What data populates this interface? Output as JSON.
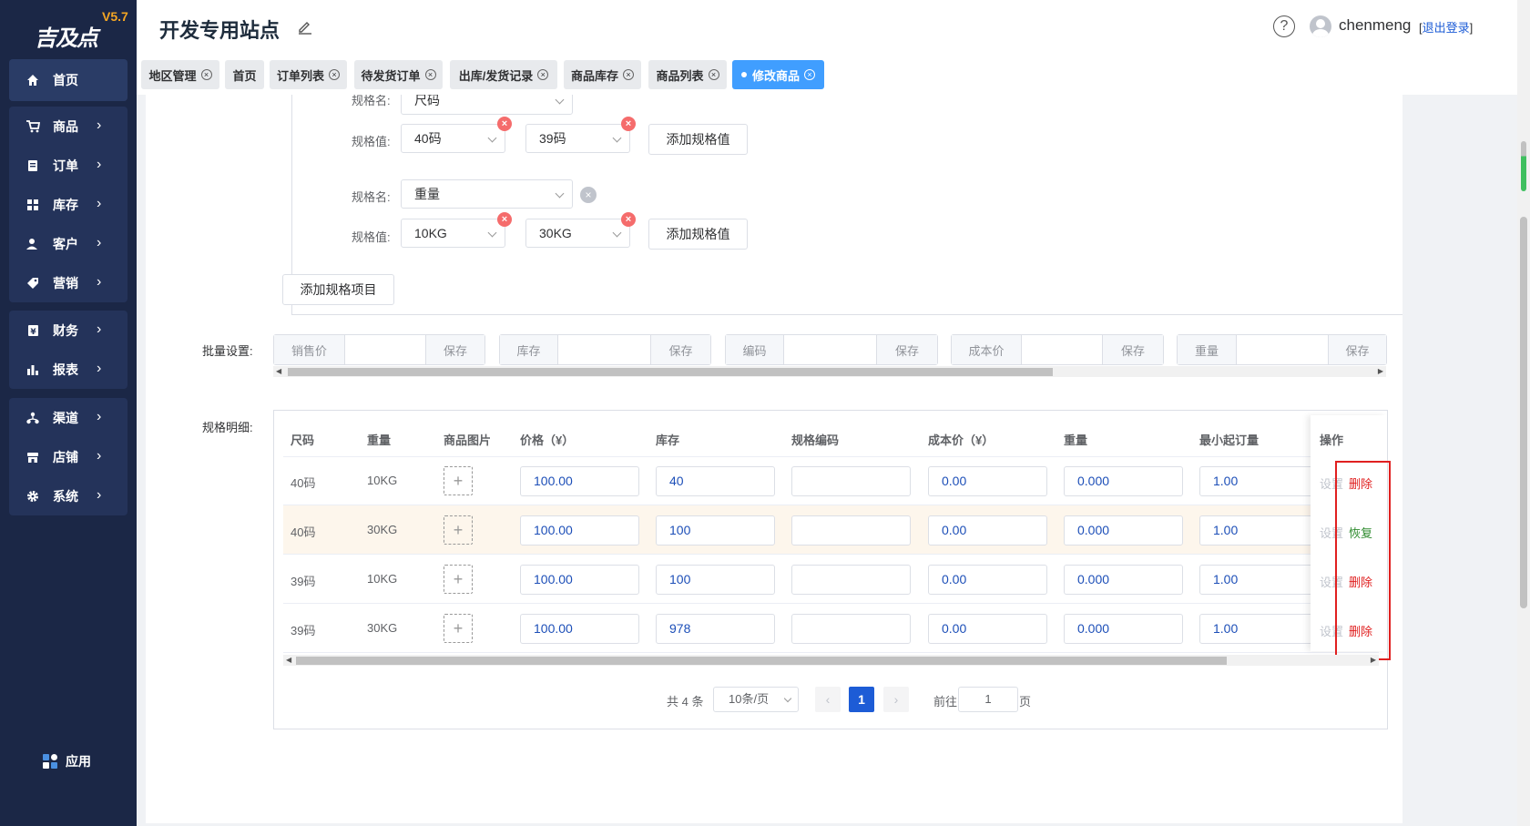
{
  "brand": {
    "logo_text": "吉及点",
    "version": "V5.7"
  },
  "sidebar": {
    "items": [
      {
        "label": "首页",
        "icon": "home-icon"
      },
      {
        "label": "商品",
        "icon": "cart-icon"
      },
      {
        "label": "订单",
        "icon": "order-icon"
      },
      {
        "label": "库存",
        "icon": "stock-icon"
      },
      {
        "label": "客户",
        "icon": "customer-icon"
      },
      {
        "label": "营销",
        "icon": "tag-icon"
      },
      {
        "label": "财务",
        "icon": "finance-icon"
      },
      {
        "label": "报表",
        "icon": "chart-icon"
      },
      {
        "label": "渠道",
        "icon": "channel-icon"
      },
      {
        "label": "店铺",
        "icon": "shop-icon"
      },
      {
        "label": "系统",
        "icon": "gear-icon"
      }
    ],
    "app_label": "应用"
  },
  "header": {
    "site_title": "开发专用站点",
    "username": "chenmeng",
    "logout_label": "退出登录"
  },
  "tabs": [
    {
      "label": "地区管理"
    },
    {
      "label": "首页"
    },
    {
      "label": "订单列表"
    },
    {
      "label": "待发货订单"
    },
    {
      "label": "出库/发货记录"
    },
    {
      "label": "商品库存"
    },
    {
      "label": "商品列表"
    },
    {
      "label": "修改商品",
      "active": true
    }
  ],
  "spec": {
    "partial_name_label": "规格名:",
    "partial_name_value": "尺码",
    "value_label": "规格值:",
    "name_label": "规格名:",
    "group1_values": [
      "40码",
      "39码"
    ],
    "group2_name": "重量",
    "group2_values": [
      "10KG",
      "30KG"
    ],
    "add_value_label": "添加规格值",
    "add_item_label": "添加规格项目"
  },
  "batch": {
    "label": "批量设置:",
    "save_label": "保存",
    "fields": [
      "销售价",
      "库存",
      "编码",
      "成本价",
      "重量"
    ]
  },
  "detail": {
    "label": "规格明细:",
    "columns": [
      "尺码",
      "重量",
      "商品图片",
      "价格（¥）",
      "库存",
      "规格编码",
      "成本价（¥）",
      "重量",
      "最小起订量",
      "操作"
    ],
    "rows": [
      {
        "size": "40码",
        "weight": "10KG",
        "price": "100.00",
        "stock": "40",
        "code": "",
        "cost": "0.00",
        "wt": "0.000",
        "moq": "1.00",
        "set": "设置",
        "action": "删除",
        "action_color": "#e02020",
        "highlight": false
      },
      {
        "size": "40码",
        "weight": "30KG",
        "price": "100.00",
        "stock": "100",
        "code": "",
        "cost": "0.00",
        "wt": "0.000",
        "moq": "1.00",
        "set": "设置",
        "action": "恢复",
        "action_color": "#2e8b2e",
        "highlight": true
      },
      {
        "size": "39码",
        "weight": "10KG",
        "price": "100.00",
        "stock": "100",
        "code": "",
        "cost": "0.00",
        "wt": "0.000",
        "moq": "1.00",
        "set": "设置",
        "action": "删除",
        "action_color": "#e02020",
        "highlight": false
      },
      {
        "size": "39码",
        "weight": "30KG",
        "price": "100.00",
        "stock": "978",
        "code": "",
        "cost": "0.00",
        "wt": "0.000",
        "moq": "1.00",
        "set": "设置",
        "action": "删除",
        "action_color": "#e02020",
        "highlight": false
      }
    ]
  },
  "pagination": {
    "total": "共 4 条",
    "page_size": "10条/页",
    "current": "1",
    "goto_label": "前往",
    "goto_value": "1",
    "page_suffix": "页"
  }
}
